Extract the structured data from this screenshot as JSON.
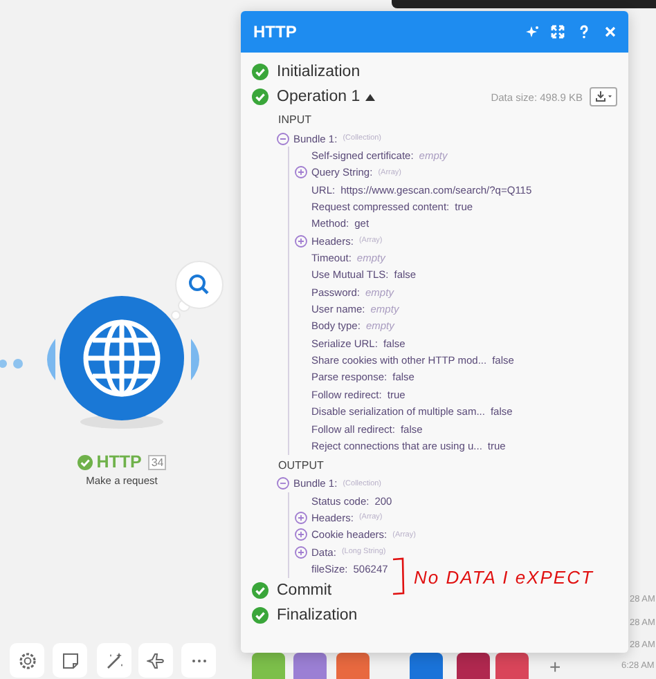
{
  "canvas": {
    "node": {
      "title": "HTTP",
      "count": "34",
      "subtitle": "Make a request"
    },
    "timestamps": [
      "28 AM",
      "28 AM",
      "28 AM",
      "6:28 AM"
    ],
    "tiles": [
      {
        "color": "#7cbf4a"
      },
      {
        "color": "#9b7fd4"
      },
      {
        "color": "#e8693f"
      },
      {
        "color": "#1a73d9"
      },
      {
        "color": "#b0284f"
      },
      {
        "color": "#d9455a"
      }
    ],
    "add_label": "+"
  },
  "panel": {
    "title": "HTTP",
    "steps": [
      {
        "kind": "step",
        "label": "Initialization"
      },
      {
        "kind": "operation",
        "label": "Operation 1",
        "expanded": true,
        "data_size": "Data size: 498.9 KB",
        "sections": [
          {
            "title": "INPUT",
            "items": [
              {
                "label": "Bundle 1:",
                "type": "(Collection)",
                "expanded": true,
                "children": [
                  {
                    "label": "Self-signed certificate:",
                    "value": "empty",
                    "empty": true
                  },
                  {
                    "label": "Query String:",
                    "type": "(Array)",
                    "expanded": false
                  },
                  {
                    "label": "URL:",
                    "value": "https://www.gescan.com/search/?q=Q115",
                    "empty": false
                  },
                  {
                    "label": "Request compressed content:",
                    "value": "true",
                    "empty": false
                  },
                  {
                    "label": "Method:",
                    "value": "get",
                    "empty": false
                  },
                  {
                    "label": "Headers:",
                    "type": "(Array)",
                    "expanded": false
                  },
                  {
                    "label": "Timeout:",
                    "value": "empty",
                    "empty": true
                  },
                  {
                    "label": "Use Mutual TLS:",
                    "value": "false",
                    "empty": false
                  },
                  {
                    "label": "Password:",
                    "value": "empty",
                    "empty": true
                  },
                  {
                    "label": "User name:",
                    "value": "empty",
                    "empty": true
                  },
                  {
                    "label": "Body type:",
                    "value": "empty",
                    "empty": true
                  },
                  {
                    "label": "Serialize URL:",
                    "value": "false",
                    "empty": false
                  },
                  {
                    "label": "Share cookies with other HTTP mod...",
                    "value": "false",
                    "empty": false
                  },
                  {
                    "label": "Parse response:",
                    "value": "false",
                    "empty": false
                  },
                  {
                    "label": "Follow redirect:",
                    "value": "true",
                    "empty": false
                  },
                  {
                    "label": "Disable serialization of multiple sam...",
                    "value": "false",
                    "empty": false
                  },
                  {
                    "label": "Follow all redirect:",
                    "value": "false",
                    "empty": false
                  },
                  {
                    "label": "Reject connections that are using u...",
                    "value": "true",
                    "empty": false
                  }
                ]
              }
            ]
          },
          {
            "title": "OUTPUT",
            "items": [
              {
                "label": "Bundle 1:",
                "type": "(Collection)",
                "expanded": true,
                "children": [
                  {
                    "label": "Status code:",
                    "value": "200",
                    "empty": false
                  },
                  {
                    "label": "Headers:",
                    "type": "(Array)",
                    "expanded": false
                  },
                  {
                    "label": "Cookie headers:",
                    "type": "(Array)",
                    "expanded": false
                  },
                  {
                    "label": "Data:",
                    "type": "(Long String)",
                    "expanded": false
                  },
                  {
                    "label": "fileSize:",
                    "value": "506247",
                    "empty": false
                  }
                ]
              }
            ]
          }
        ]
      },
      {
        "kind": "step",
        "label": "Commit"
      },
      {
        "kind": "step",
        "label": "Finalization"
      }
    ],
    "annotation": "No DATA I eXPECT"
  }
}
